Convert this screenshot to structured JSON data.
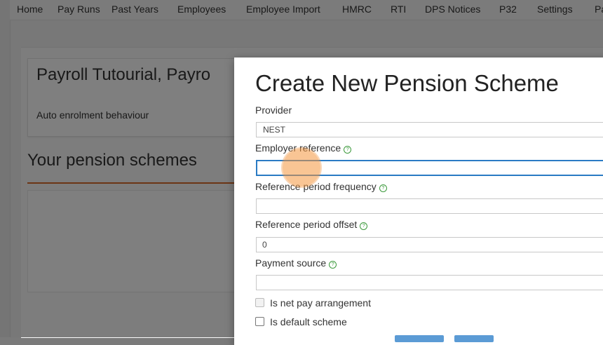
{
  "nav": {
    "items": [
      "Home",
      "Pay Runs",
      "Past Years",
      "Employees",
      "Employee Import",
      "HMRC",
      "RTI",
      "DPS Notices",
      "P32",
      "Settings",
      "Pa"
    ]
  },
  "background": {
    "company_title": "Payroll Tutourial, Payro",
    "auto_enrolment_label": "Auto enrolment behaviour",
    "section_title": "Your pension schemes"
  },
  "modal": {
    "title": "Create New Pension Scheme",
    "provider": {
      "label": "Provider",
      "value": "NEST"
    },
    "employer_reference": {
      "label": "Employer reference",
      "value": ""
    },
    "reference_period_frequency": {
      "label": "Reference period frequency",
      "value": ""
    },
    "reference_period_offset": {
      "label": "Reference period offset",
      "value": "0"
    },
    "payment_source": {
      "label": "Payment source",
      "value": ""
    },
    "net_pay": {
      "label": "Is net pay arrangement",
      "checked": false,
      "disabled": true
    },
    "default_scheme": {
      "label": "Is default scheme",
      "checked": false
    }
  },
  "colors": {
    "accent_rule": "#d96a2b",
    "focus_border": "#2a7bc4",
    "help_icon": "#3c9a3c",
    "click_highlight": "#f4963c"
  },
  "icons": {
    "help": "help-circle-icon",
    "cursor": "click-indicator"
  }
}
